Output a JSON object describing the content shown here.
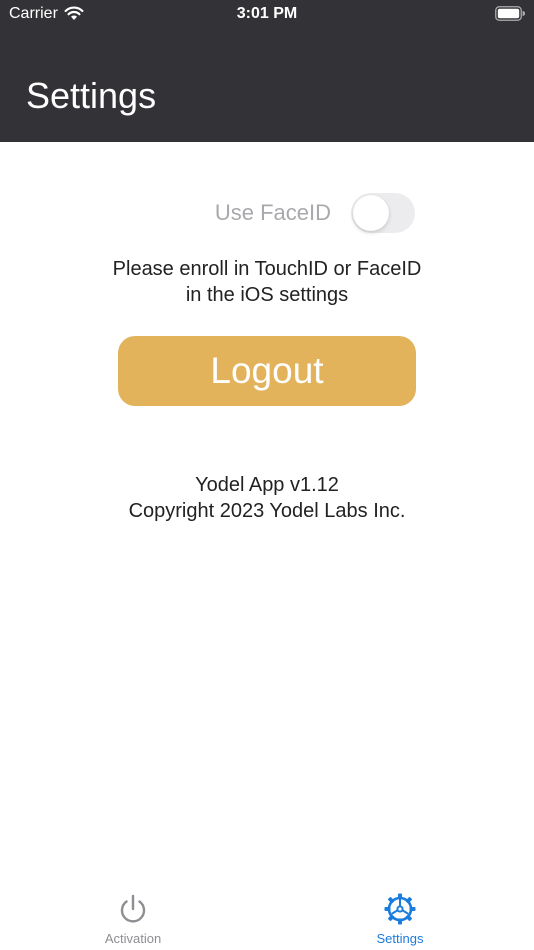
{
  "status_bar": {
    "carrier": "Carrier",
    "time": "3:01 PM",
    "icons": [
      "wifi-icon",
      "battery-icon"
    ]
  },
  "nav": {
    "title": "Settings"
  },
  "faceid": {
    "label": "Use FaceID",
    "enabled": false,
    "disabled_appearance": true
  },
  "enroll_message": {
    "line1": "Please enroll in TouchID or FaceID",
    "line2": "in the iOS settings"
  },
  "logout": {
    "label": "Logout"
  },
  "about": {
    "version": "Yodel App v1.12",
    "copyright": "Copyright 2023 Yodel Labs Inc."
  },
  "tab_bar": {
    "tabs": [
      {
        "label": "Activation",
        "icon": "power-icon",
        "selected": false
      },
      {
        "label": "Settings",
        "icon": "gear-icon",
        "selected": true
      }
    ]
  },
  "colors": {
    "header_bg": "#333337",
    "logout_button": "#e3b35c",
    "tab_selected": "#1a7cdd",
    "tab_unselected": "#8e8e93",
    "disabled_text": "#a9a9ad"
  }
}
